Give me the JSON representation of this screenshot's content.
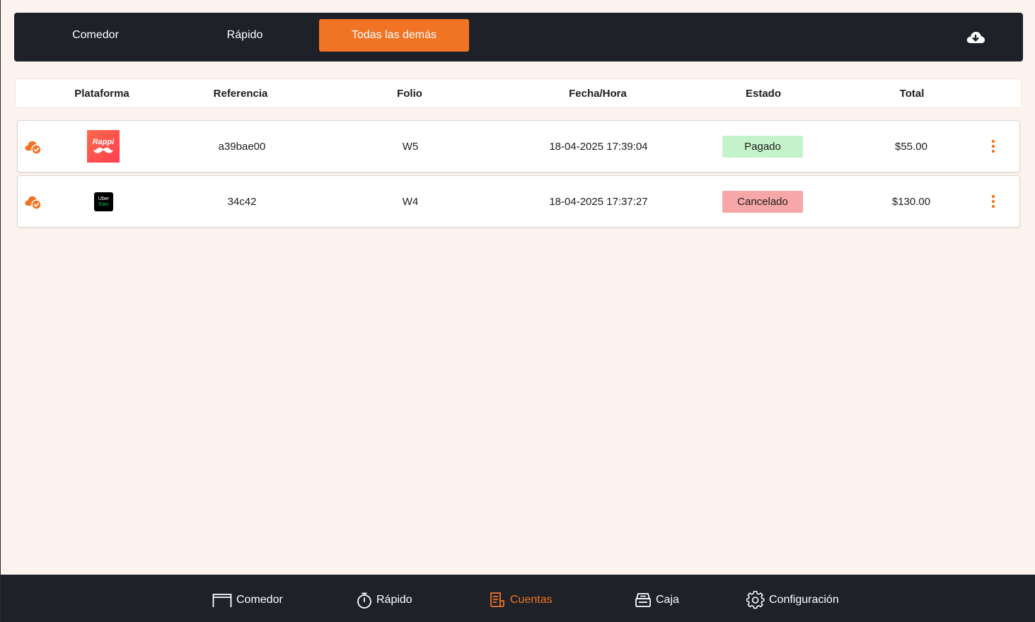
{
  "top_tabs": [
    {
      "label": "Comedor",
      "active": false
    },
    {
      "label": "Rápido",
      "active": false
    },
    {
      "label": "Todas las demás",
      "active": true
    }
  ],
  "download_icon": "cloud-download-icon",
  "table": {
    "headers": [
      "Plataforma",
      "Referencia",
      "Folio",
      "Fecha/Hora",
      "Estado",
      "Total"
    ],
    "rows": [
      {
        "sync_icon": "cloud-check-icon",
        "platform": "Rappi",
        "platform_logo_text": "Rappi",
        "reference": "a39bae00",
        "folio": "W5",
        "datetime": "18-04-2025 17:39:04",
        "status": "Pagado",
        "status_color": "#c5f3c9",
        "total": "$55.00"
      },
      {
        "sync_icon": "cloud-check-icon",
        "platform": "Uber Eats",
        "platform_logo_text": [
          "Uber",
          "Eats"
        ],
        "reference": "34c42",
        "folio": "W4",
        "datetime": "18-04-2025 17:37:27",
        "status": "Cancelado",
        "status_color": "#f7a7a7",
        "total": "$130.00"
      }
    ]
  },
  "bottom_nav": [
    {
      "label": "Comedor",
      "icon": "table-icon",
      "active": false
    },
    {
      "label": "Rápido",
      "icon": "stopwatch-icon",
      "active": false
    },
    {
      "label": "Cuentas",
      "icon": "receipt-icon",
      "active": true
    },
    {
      "label": "Caja",
      "icon": "cash-register-icon",
      "active": false
    },
    {
      "label": "Configuración",
      "icon": "gear-icon",
      "active": false
    }
  ],
  "colors": {
    "accent": "#f07424",
    "bar_background": "#1f2128",
    "page_background": "#fdf3ee"
  }
}
